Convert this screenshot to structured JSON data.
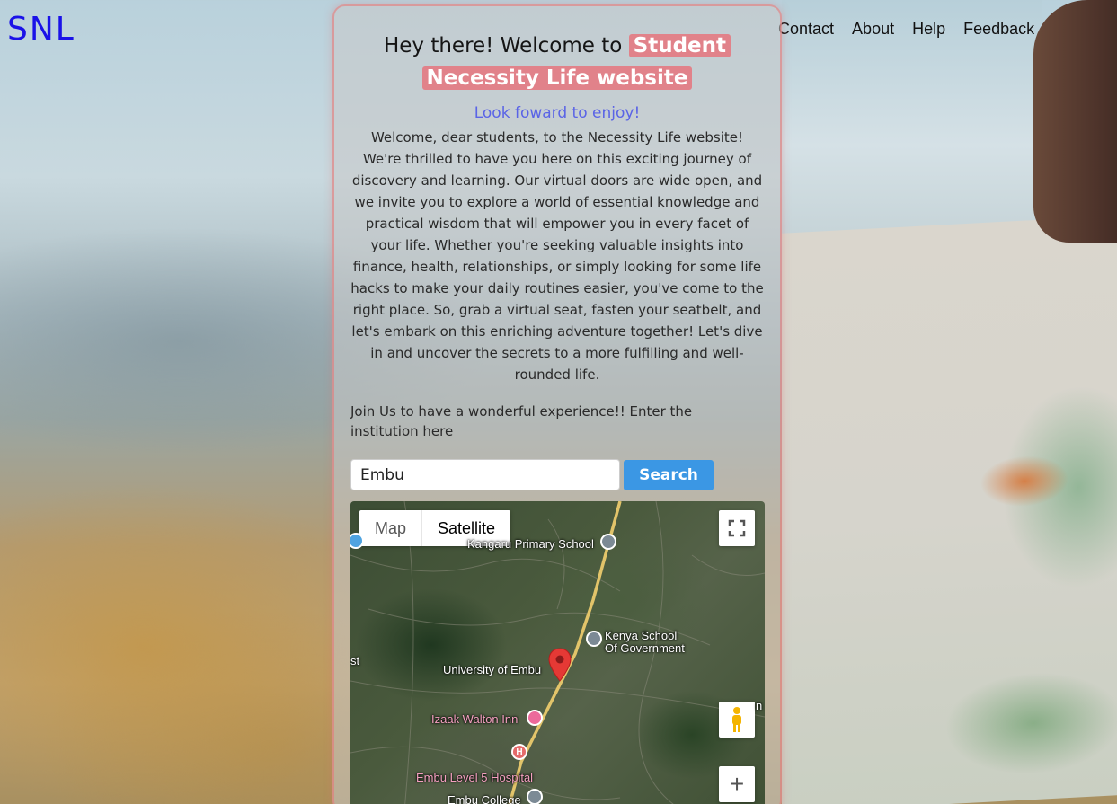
{
  "header": {
    "logo": "SNL",
    "nav": [
      "Contact",
      "About",
      "Help",
      "Feedback"
    ]
  },
  "card": {
    "title_prefix": "Hey there! Welcome to ",
    "title_highlight_line1": "Student",
    "title_highlight_line2": "Necessity Life website",
    "subtitle": "Look foward to enjoy!",
    "body": "Welcome, dear students, to the Necessity Life website! We're thrilled to have you here on this exciting journey of discovery and learning. Our virtual doors are wide open, and we invite you to explore a world of essential knowledge and practical wisdom that will empower you in every facet of your life. Whether you're seeking valuable insights into finance, health, relationships, or simply looking for some life hacks to make your daily routines easier, you've come to the right place. So, grab a virtual seat, fasten your seatbelt, and let's embark on this enriching adventure together! Let's dive in and uncover the secrets to a more fulfilling and well-rounded life.",
    "join_text": "Join Us to have a wonderful experience!! Enter the institution here"
  },
  "search": {
    "value": "Embu",
    "button": "Search"
  },
  "map": {
    "type_map": "Map",
    "type_satellite": "Satellite",
    "zoom_in": "+",
    "labels": {
      "primary_school": "Kangaru Primary School",
      "kenya_school_1": "Kenya School",
      "kenya_school_2": "Of Government",
      "university": "University of Embu",
      "izaak": "Izaak Walton Inn",
      "hospital": "Embu Level 5 Hospital",
      "college": "Embu College",
      "edge_left": "st",
      "edge_right": "n"
    },
    "icons": {
      "hospital_letter": "H"
    }
  }
}
